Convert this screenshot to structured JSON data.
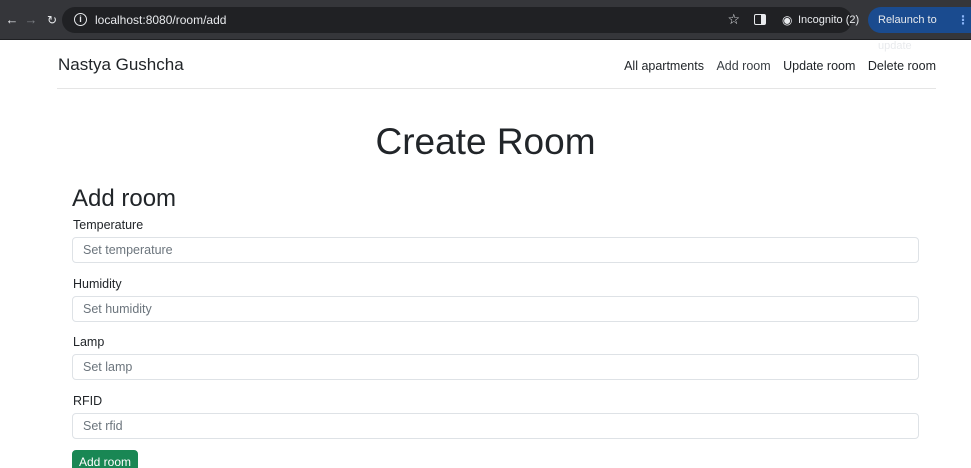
{
  "browser": {
    "url": "localhost:8080/room/add",
    "incognito_label": "Incognito (2)",
    "relaunch_label": "Relaunch to update"
  },
  "header": {
    "brand": "Nastya Gushcha",
    "nav": {
      "all_apartments": "All apartments",
      "add_room": "Add room",
      "update_room": "Update room",
      "delete_room": "Delete room"
    }
  },
  "page": {
    "title": "Create Room"
  },
  "form": {
    "title": "Add room",
    "fields": [
      {
        "label": "Temperature",
        "placeholder": "Set temperature",
        "value": ""
      },
      {
        "label": "Humidity",
        "placeholder": "Set humidity",
        "value": ""
      },
      {
        "label": "Lamp",
        "placeholder": "Set lamp",
        "value": ""
      },
      {
        "label": "RFID",
        "placeholder": "Set rfid",
        "value": ""
      }
    ],
    "submit_label": "Add room"
  },
  "colors": {
    "submit_button": "#198754",
    "chrome_bar": "#35363a",
    "relaunch_button": "#1a4b8f"
  }
}
